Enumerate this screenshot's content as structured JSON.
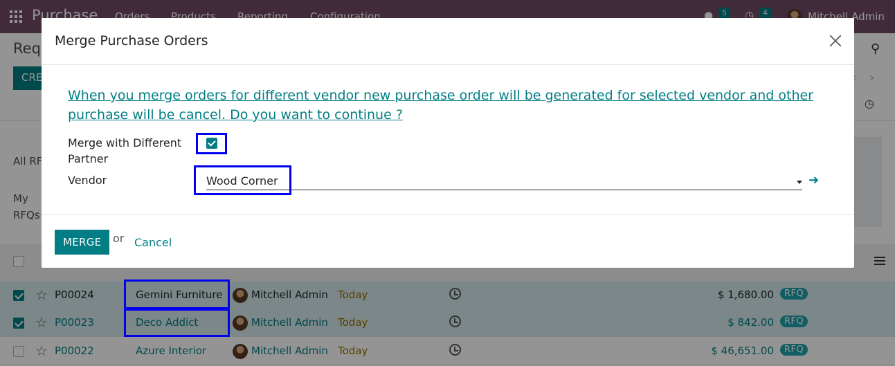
{
  "navbar": {
    "app_name": "Purchase",
    "menu": [
      "Orders",
      "Products",
      "Reporting",
      "Configuration"
    ],
    "messages_count": "5",
    "activities_count": "4",
    "user": "Mitchell Admin"
  },
  "background": {
    "page_title": "Req",
    "create_label": "CRE",
    "filters": [
      "All RF",
      "My",
      "RFQs"
    ],
    "rows": [
      {
        "selected": true,
        "ref": "P00024",
        "vendor": "Gemini Furniture",
        "buyer": "Mitchell Admin",
        "deadline": "Today",
        "amount": "$ 1,680.00",
        "status": "RFQ"
      },
      {
        "selected": true,
        "ref": "P00023",
        "vendor": "Deco Addict",
        "buyer": "Mitchell Admin",
        "deadline": "Today",
        "amount": "$ 842.00",
        "status": "RFQ"
      },
      {
        "selected": false,
        "ref": "P00022",
        "vendor": "Azure Interior",
        "buyer": "Mitchell Admin",
        "deadline": "Today",
        "amount": "$ 46,651.00",
        "status": "RFQ"
      }
    ]
  },
  "modal": {
    "title": "Merge Purchase Orders",
    "warning": "When you merge orders for different vendor new purchase order will be generated for selected vendor and other purchase will be cancel. Do you want to continue ?",
    "merge_partner_label": "Merge with Different Partner",
    "merge_partner_checked": true,
    "vendor_label": "Vendor",
    "vendor_value": "Wood Corner",
    "merge_label": "MERGE",
    "or_text": "or",
    "cancel_label": "Cancel"
  },
  "colors": {
    "primary": "#017e84",
    "navbar": "#714b67",
    "highlight": "#0000ee"
  }
}
